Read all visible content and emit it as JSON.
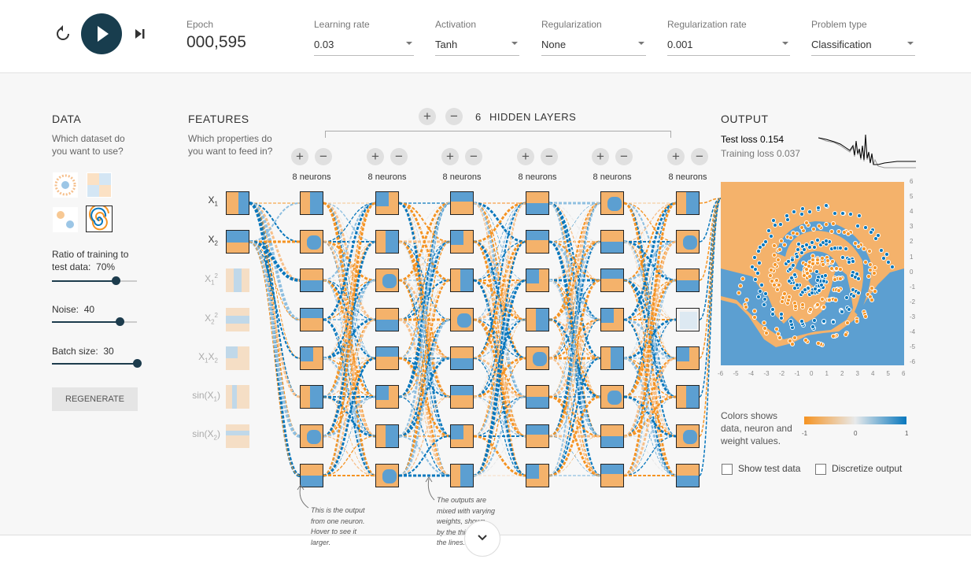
{
  "controls": {
    "epoch_label": "Epoch",
    "epoch_value": "000,595",
    "learning_rate": {
      "label": "Learning rate",
      "value": "0.03"
    },
    "activation": {
      "label": "Activation",
      "value": "Tanh"
    },
    "regularization": {
      "label": "Regularization",
      "value": "None"
    },
    "regularization_rate": {
      "label": "Regularization rate",
      "value": "0.001"
    },
    "problem_type": {
      "label": "Problem type",
      "value": "Classification"
    }
  },
  "data_panel": {
    "title": "DATA",
    "subtitle_line1": "Which dataset do",
    "subtitle_line2": "you want to use?",
    "selected_dataset": "spiral",
    "ratio_label_line1": "Ratio of training to",
    "ratio_label_line2": "test data:",
    "ratio_value": "70%",
    "ratio_fraction": 0.7,
    "noise_label": "Noise:",
    "noise_value": "40",
    "noise_fraction": 0.8,
    "batch_label": "Batch size:",
    "batch_value": "30",
    "batch_fraction": 1.0,
    "regenerate_label": "REGENERATE"
  },
  "features_panel": {
    "title": "FEATURES",
    "subtitle_line1": "Which properties do",
    "subtitle_line2": "you want to feed in?",
    "features": [
      {
        "label": "X",
        "sub": "1",
        "active": true
      },
      {
        "label": "X",
        "sub": "2",
        "active": true
      },
      {
        "label": "X",
        "sub": "1",
        "sup": "2",
        "active": false
      },
      {
        "label": "X",
        "sub": "2",
        "sup": "2",
        "active": false
      },
      {
        "label": "X",
        "sub": "1",
        "label2": "X",
        "sub2": "2",
        "active": false
      },
      {
        "label": "sin(X",
        "sub": "1",
        "tail": ")",
        "active": false
      },
      {
        "label": "sin(X",
        "sub": "2",
        "tail": ")",
        "active": false
      }
    ]
  },
  "network": {
    "hidden_layers_count": "6",
    "hidden_layers_label": "HIDDEN LAYERS",
    "plus": "+",
    "minus": "−",
    "layers": [
      {
        "neurons_label": "8 neurons"
      },
      {
        "neurons_label": "8 neurons"
      },
      {
        "neurons_label": "8 neurons"
      },
      {
        "neurons_label": "8 neurons"
      },
      {
        "neurons_label": "8 neurons"
      },
      {
        "neurons_label": "8 neurons"
      }
    ],
    "annotation1": [
      "This is the output",
      "from one neuron.",
      "Hover to see it",
      "larger."
    ],
    "annotation2": [
      "The outputs are",
      "mixed with varying",
      "weights, shown",
      "by the thickness of",
      "the lines."
    ]
  },
  "output_panel": {
    "title": "OUTPUT",
    "test_loss_label": "Test loss",
    "test_loss_value": "0.154",
    "training_loss_label": "Training loss",
    "training_loss_value": "0.037",
    "axis_ticks": [
      "6",
      "5",
      "4",
      "3",
      "2",
      "1",
      "0",
      "-1",
      "-2",
      "-3",
      "-4",
      "-5",
      "-6"
    ],
    "x_ticks": [
      "-6",
      "-5",
      "-4",
      "-3",
      "-2",
      "-1",
      "0",
      "1",
      "2",
      "3",
      "4",
      "5",
      "6"
    ],
    "legend_line1": "Colors shows",
    "legend_line2": "data, neuron and",
    "legend_line3": "weight values.",
    "legend_min": "-1",
    "legend_mid": "0",
    "legend_max": "1",
    "show_test_data_label": "Show test data",
    "discretize_label": "Discretize output"
  },
  "colors": {
    "orange": "#f59322",
    "blue": "#0877bd",
    "dark": "#183d4e"
  }
}
